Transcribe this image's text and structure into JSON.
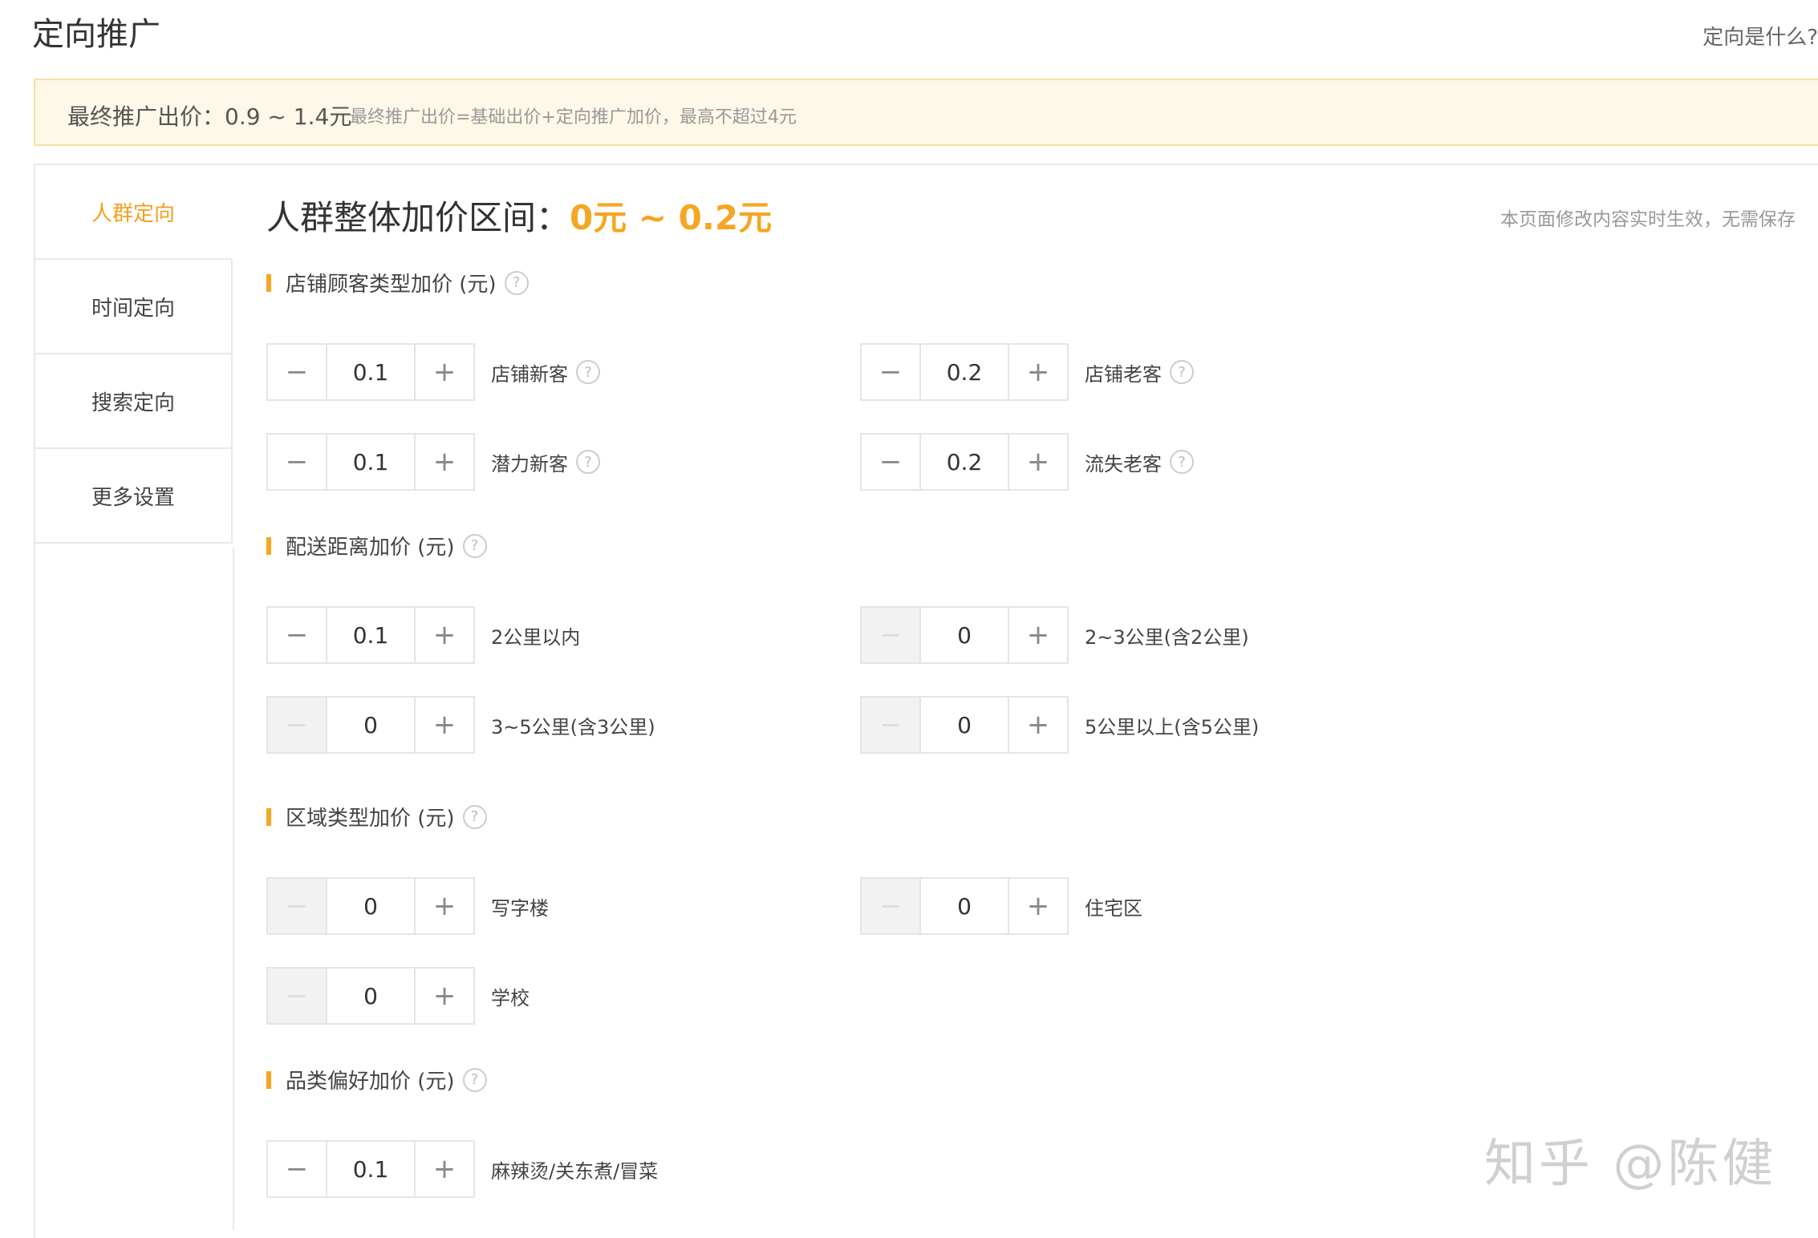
{
  "header": {
    "title": "定向推广",
    "help_link": "定向是什么?"
  },
  "notice": {
    "main": "最终推广出价：0.9 ~ 1.4元",
    "sub": "最终推广出价=基础出价+定向推广加价，最高不超过4元"
  },
  "sidebar": {
    "items": [
      {
        "label": "人群定向",
        "active": true
      },
      {
        "label": "时间定向"
      },
      {
        "label": "搜索定向"
      },
      {
        "label": "更多设置"
      }
    ]
  },
  "main": {
    "heading_prefix": "人群整体加价区间：",
    "heading_range": "0元 ~ 0.2元",
    "save_note": "本页面修改内容实时生效，无需保存",
    "sections": [
      {
        "title": "店铺顾客类型加价 (元)",
        "items": [
          {
            "value": "0.1",
            "label": "店铺新客",
            "help": true,
            "minus_disabled": false
          },
          {
            "value": "0.2",
            "label": "店铺老客",
            "help": true,
            "minus_disabled": false
          },
          {
            "value": "0.1",
            "label": "潜力新客",
            "help": true,
            "minus_disabled": false
          },
          {
            "value": "0.2",
            "label": "流失老客",
            "help": true,
            "minus_disabled": false
          }
        ]
      },
      {
        "title": "配送距离加价 (元)",
        "items": [
          {
            "value": "0.1",
            "label": "2公里以内",
            "minus_disabled": false
          },
          {
            "value": "0",
            "label": "2~3公里(含2公里)",
            "minus_disabled": true
          },
          {
            "value": "0",
            "label": "3~5公里(含3公里)",
            "minus_disabled": true
          },
          {
            "value": "0",
            "label": "5公里以上(含5公里)",
            "minus_disabled": true
          }
        ]
      },
      {
        "title": "区域类型加价 (元)",
        "items": [
          {
            "value": "0",
            "label": "写字楼",
            "minus_disabled": true
          },
          {
            "value": "0",
            "label": "住宅区",
            "minus_disabled": true
          },
          {
            "value": "0",
            "label": "学校",
            "minus_disabled": true
          }
        ]
      },
      {
        "title": "品类偏好加价 (元)",
        "items": [
          {
            "value": "0.1",
            "label": "麻辣烫/关东煮/冒菜",
            "minus_disabled": false
          }
        ]
      }
    ]
  },
  "controls": {
    "minus": "−",
    "plus": "+",
    "help": "?"
  },
  "watermark": "知乎 @陈健"
}
